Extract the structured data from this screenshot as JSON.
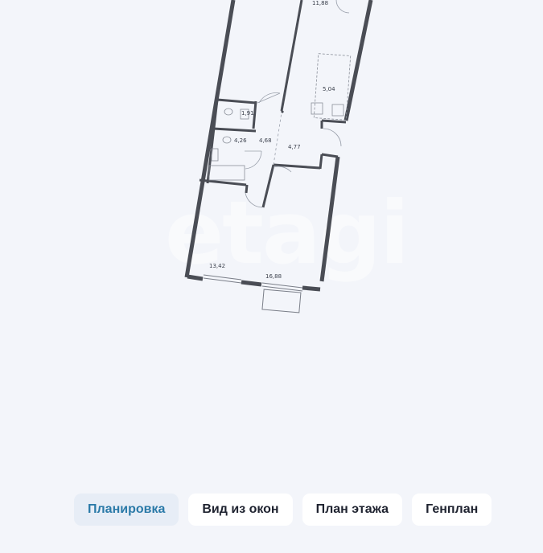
{
  "watermark": "etagi",
  "rooms": [
    {
      "id": "room-top",
      "area": "11,88"
    },
    {
      "id": "kitchen",
      "area": "5,04"
    },
    {
      "id": "toilet",
      "area": "1,91"
    },
    {
      "id": "bathroom",
      "area": "4,26"
    },
    {
      "id": "corridor",
      "area": "4,68"
    },
    {
      "id": "hall",
      "area": "4,77"
    },
    {
      "id": "bedroom-left",
      "area": "13,42"
    },
    {
      "id": "bedroom-right",
      "area": "16,88"
    }
  ],
  "tabs": [
    {
      "label": "Планировка",
      "active": true
    },
    {
      "label": "Вид из окон",
      "active": false
    },
    {
      "label": "План этажа",
      "active": false
    },
    {
      "label": "Генплан",
      "active": false
    }
  ],
  "colors": {
    "wall": "#4a4d55",
    "accent": "#2b7aa8",
    "background": "#f3f5fa"
  }
}
